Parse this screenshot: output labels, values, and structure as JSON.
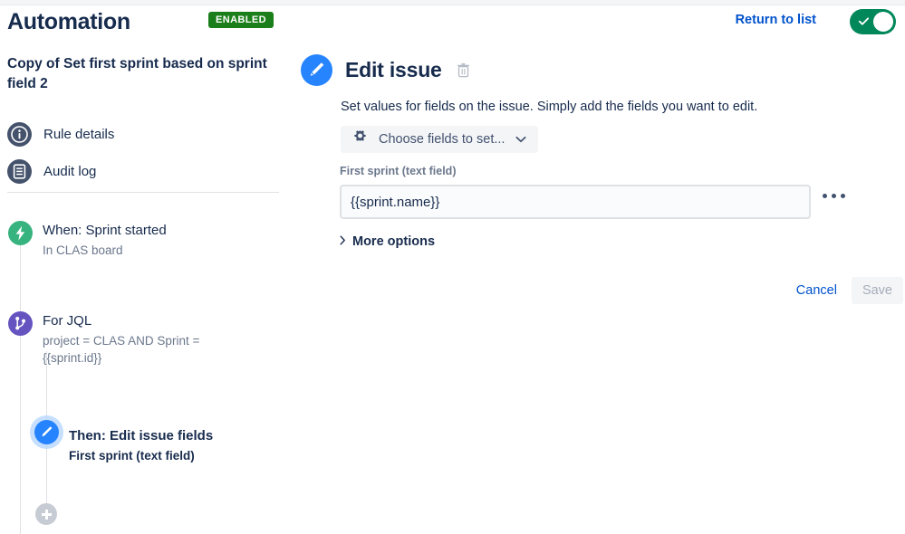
{
  "header": {
    "title": "Automation",
    "status_badge": "ENABLED",
    "status_badge_color": "#1a7f1a",
    "return_link": "Return to list",
    "toggle_on": true,
    "toggle_color": "#00875a"
  },
  "sidebar": {
    "rule_name": "Copy of Set first sprint based on sprint field 2",
    "nav": [
      {
        "label": "Rule details",
        "icon": "info-icon"
      },
      {
        "label": "Audit log",
        "icon": "audit-log-icon"
      }
    ],
    "tree": [
      {
        "title": "When: Sprint started",
        "subtitle": "In CLAS board",
        "icon": "lightning-icon",
        "icon_color": "#36b37e",
        "selected": false
      },
      {
        "title": "For JQL",
        "subtitle": "project = CLAS AND Sprint = {{sprint.id}}",
        "icon": "branch-icon",
        "icon_color": "#6554c0",
        "selected": false
      },
      {
        "title": "Then: Edit issue fields",
        "subtitle": "First sprint (text field)",
        "icon": "pencil-icon",
        "icon_color": "#2684ff",
        "selected": true
      }
    ],
    "add_component_label": "+"
  },
  "main": {
    "icon": "pencil-icon",
    "title": "Edit issue",
    "delete_icon": "trash-icon",
    "description": "Set values for fields on the issue. Simply add the fields you want to edit.",
    "choose_fields": {
      "icon": "gear-icon",
      "label": "Choose fields to set...",
      "chevron": "chevron-down-icon"
    },
    "field": {
      "label": "First sprint (text field)",
      "value": "{{sprint.name}}",
      "placeholder": "",
      "overflow_menu": "more-options-icon"
    },
    "more_options_label": "More options",
    "buttons": {
      "cancel": "Cancel",
      "save": "Save",
      "save_disabled": true
    }
  }
}
